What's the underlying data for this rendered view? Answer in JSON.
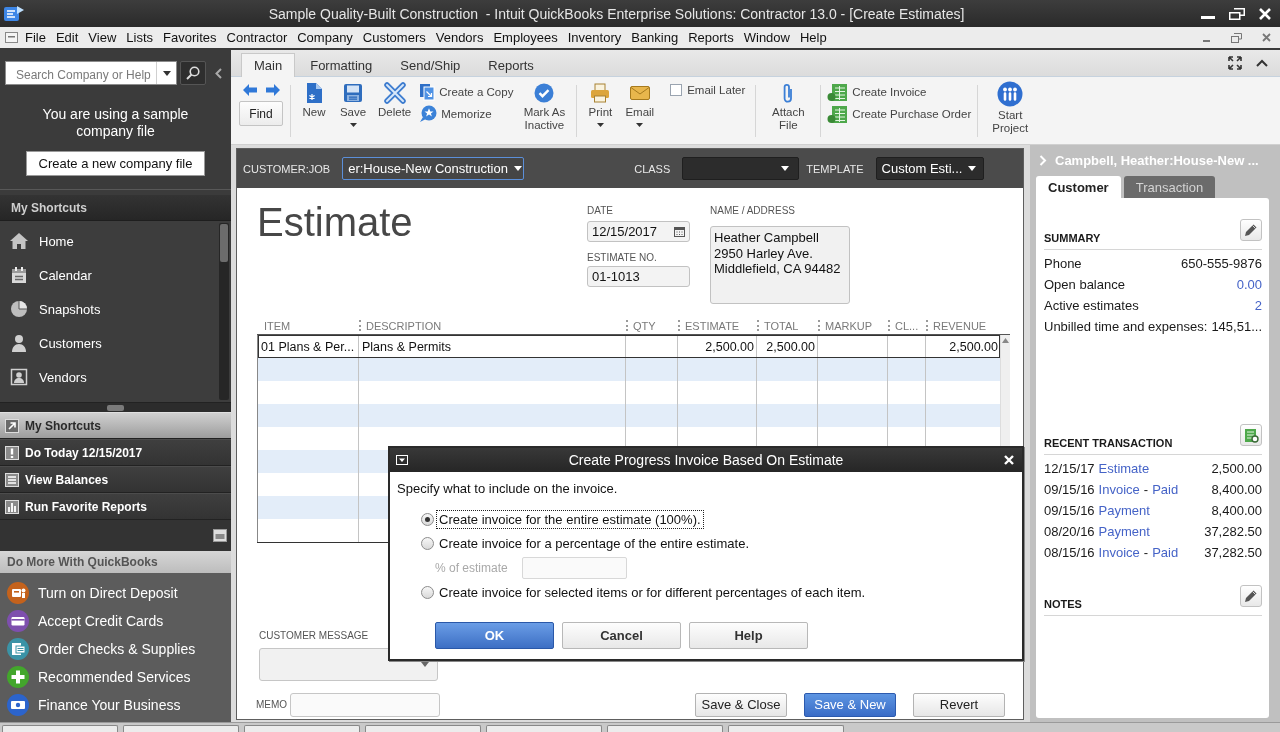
{
  "window": {
    "title": "Sample Quality-Built Construction  - Intuit QuickBooks Enterprise Solutions: Contractor 13.0 - [Create Estimates]"
  },
  "menu_bar": {
    "items": [
      "File",
      "Edit",
      "View",
      "Lists",
      "Favorites",
      "Contractor",
      "Company",
      "Customers",
      "Vendors",
      "Employees",
      "Inventory",
      "Banking",
      "Reports",
      "Window",
      "Help"
    ]
  },
  "sidebar": {
    "search": {
      "placeholder": "Search Company or Help"
    },
    "notice": "You are using a sample company file",
    "create_button": "Create a new company file",
    "shortcuts": {
      "title": "My Shortcuts",
      "items": [
        "Home",
        "Calendar",
        "Snapshots",
        "Customers",
        "Vendors"
      ]
    },
    "sections": [
      {
        "label": "My Shortcuts",
        "selected": true
      },
      {
        "label": "Do Today 12/15/2017",
        "selected": false
      },
      {
        "label": "View Balances",
        "selected": false
      },
      {
        "label": "Run Favorite Reports",
        "selected": false
      }
    ],
    "do_more": {
      "title": "Do More With QuickBooks",
      "items": [
        {
          "label": "Turn on Direct Deposit",
          "color": "#c4621c"
        },
        {
          "label": "Accept Credit Cards",
          "color": "#7e4fae"
        },
        {
          "label": "Order Checks & Supplies",
          "color": "#3b93a6"
        },
        {
          "label": "Recommended Services",
          "color": "#43a62c"
        },
        {
          "label": "Finance Your Business",
          "color": "#2c64cc"
        }
      ]
    }
  },
  "toolbar": {
    "tabs": [
      {
        "label": "Main",
        "selected": true
      },
      {
        "label": "Formatting",
        "selected": false
      },
      {
        "label": "Send/Ship",
        "selected": false
      },
      {
        "label": "Reports",
        "selected": false
      }
    ],
    "find_button": "Find",
    "groups": [
      [
        {
          "kind": "large",
          "label": "New"
        },
        {
          "kind": "menu",
          "label": "Save"
        },
        {
          "kind": "large",
          "label": "Delete"
        },
        {
          "kind": "stack",
          "items": [
            "Create a Copy",
            "Memorize"
          ]
        },
        {
          "kind": "large",
          "label": "Mark As Inactive"
        }
      ],
      [
        {
          "kind": "menu",
          "label": "Print"
        },
        {
          "kind": "menu",
          "label": "Email"
        },
        {
          "kind": "check",
          "label": "Email Later",
          "checked": false
        }
      ],
      [
        {
          "kind": "large",
          "label": "Attach File"
        }
      ],
      [
        {
          "kind": "stack",
          "items": [
            "Create Invoice",
            "Create Purchase Order"
          ]
        }
      ],
      [
        {
          "kind": "large",
          "label": "Start Project"
        }
      ]
    ]
  },
  "form": {
    "customer_job": {
      "label": "CUSTOMER:JOB",
      "value": "er:House-New Construction"
    },
    "class": {
      "label": "CLASS"
    },
    "template": {
      "label": "TEMPLATE",
      "value": "Custom Esti..."
    },
    "title": "Estimate",
    "date": {
      "label": "DATE",
      "value": "12/15/2017"
    },
    "estimate_no": {
      "label": "ESTIMATE NO.",
      "value": "01-1013"
    },
    "name_address": {
      "label": "NAME / ADDRESS",
      "lines": [
        "Heather Campbell",
        "2950 Harley Ave.",
        "Middlefield, CA 94482"
      ]
    },
    "table": {
      "columns": [
        "ITEM",
        "DESCRIPTION",
        "QTY",
        "ESTIMATE",
        "TOTAL",
        "MARKUP",
        "CL...",
        "REVENUE"
      ],
      "rows": [
        {
          "selected": true,
          "item": "01 Plans & Per...",
          "description": "Plans & Permits",
          "estimate": "2,500.00",
          "total": "2,500.00",
          "revenue": "2,500.00"
        }
      ]
    },
    "customer_message": {
      "label": "CUSTOMER MESSAGE"
    },
    "memo": {
      "label": "MEMO"
    },
    "buttons": [
      {
        "label": "Save & Close",
        "primary": false
      },
      {
        "label": "Save & New",
        "primary": true
      },
      {
        "label": "Revert",
        "primary": false
      }
    ]
  },
  "dialog": {
    "title": "Create Progress Invoice Based On Estimate",
    "prompt": "Specify what to include on the invoice.",
    "options": [
      {
        "label": "Create invoice for the entire estimate (100%).",
        "selected": true
      },
      {
        "label": "Create invoice for a percentage of the entire estimate.",
        "selected": false,
        "percent_field": {
          "label": "% of estimate",
          "disabled": true
        }
      },
      {
        "label": "Create invoice for selected items or for different percentages of each item.",
        "selected": false
      }
    ],
    "buttons": [
      {
        "label": "OK",
        "primary": true
      },
      {
        "label": "Cancel",
        "primary": false
      },
      {
        "label": "Help",
        "primary": false
      }
    ]
  },
  "customer_panel": {
    "title": "Campbell, Heather:House-New ...",
    "tabs": [
      {
        "label": "Customer",
        "selected": true
      },
      {
        "label": "Transaction",
        "selected": false
      }
    ],
    "summary": {
      "heading": "SUMMARY",
      "rows": [
        {
          "label": "Phone",
          "value": "650-555-9876",
          "link": false
        },
        {
          "label": "Open balance",
          "value": "0.00",
          "link": true
        },
        {
          "label": "Active estimates",
          "value": "2",
          "link": true
        },
        {
          "label": "Unbilled time and expenses:",
          "value": "145,51...",
          "link": false
        }
      ]
    },
    "recent_transactions": {
      "heading": "RECENT TRANSACTION",
      "rows": [
        {
          "date": "12/15/17",
          "type": "Estimate",
          "amount": "2,500.00"
        },
        {
          "date": "09/15/16",
          "type": "Invoice",
          "separator": "-",
          "status": "Paid",
          "amount": "8,400.00"
        },
        {
          "date": "09/15/16",
          "type": "Payment",
          "amount": "8,400.00"
        },
        {
          "date": "08/20/16",
          "type": "Payment",
          "amount": "37,282.50"
        },
        {
          "date": "08/15/16",
          "type": "Invoice",
          "separator": "-",
          "status": "Paid",
          "amount": "37,282.50"
        }
      ]
    },
    "notes": {
      "heading": "NOTES"
    }
  }
}
